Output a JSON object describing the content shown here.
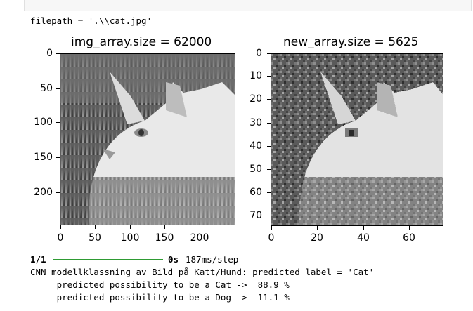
{
  "output": {
    "filepath_line": "filepath = '.\\\\cat.jpg'",
    "progress_count": "1/1",
    "progress_time": "0s",
    "progress_rate": "187ms/step",
    "progress_fraction": 1.0,
    "classification_line": "CNN modellklassning av Bild på Katt/Hund: predicted_label = 'Cat'",
    "cat_line": "     predicted possibility to be a Cat ->  88.9 %",
    "dog_line": "     predicted possibility to be a Dog ->  11.1 %"
  },
  "plots": [
    {
      "title": "img_array.size = 62000",
      "y_ticks": [
        "0",
        "50",
        "100",
        "150",
        "200"
      ],
      "x_ticks": [
        "0",
        "50",
        "100",
        "150",
        "200"
      ],
      "image": "grayscale photo of a cat lying in grass"
    },
    {
      "title": "new_array.size = 5625",
      "y_ticks": [
        "0",
        "10",
        "20",
        "30",
        "40",
        "50",
        "60",
        "70"
      ],
      "x_ticks": [
        "0",
        "20",
        "40",
        "60"
      ],
      "image": "pixelated grayscale photo of a cat lying in grass"
    }
  ],
  "colors": {
    "progress_bar": "#2e9b33",
    "cell_background": "#f7f7f7"
  }
}
